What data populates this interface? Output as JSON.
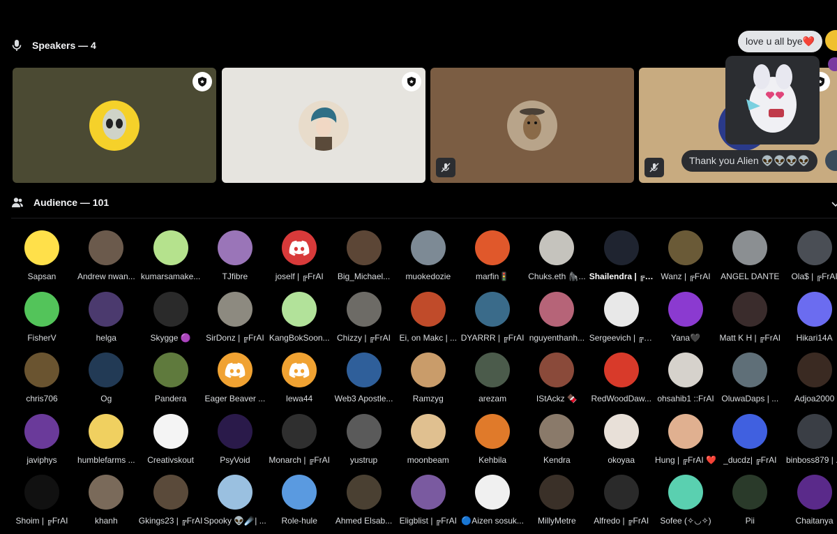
{
  "speakers": {
    "header": "Speakers — 4"
  },
  "audience": {
    "header": "Audience — 101"
  },
  "reactions": {
    "top": "love u all bye❤️",
    "bottom": "Thank you Alien 👽👽👽👽"
  },
  "colors": {
    "background": "#000000",
    "tile1": "#4b4a33",
    "tile2": "#e6e4df",
    "tile3": "#7b5d43",
    "tile4": "#c8ab80",
    "discord_red": "#d83a3a",
    "discord_orange": "#f0a232"
  },
  "icons": {
    "speakers": "microphone-icon",
    "audience": "people-icon",
    "badge": "stage-moderator-icon",
    "mute": "muted-mic-icon"
  },
  "audience_rows": [
    [
      {
        "name": "Sapsan",
        "color": "#ffe04a"
      },
      {
        "name": "Andrew nwan...",
        "color": "#6b5a4c"
      },
      {
        "name": "kumarsamake...",
        "color": "#b5e28d"
      },
      {
        "name": "TJfibre",
        "color": "#9a75b8"
      },
      {
        "name": "joself | ╔FrAI",
        "color": "#d83a3a",
        "discord": true
      },
      {
        "name": "Big_Michael...",
        "color": "#5c4636"
      },
      {
        "name": "muokedozie",
        "color": "#7d8a95"
      },
      {
        "name": "marfin🚦",
        "color": "#e0582b"
      },
      {
        "name": "Chuks.eth 🦍...",
        "color": "#c5c3bd"
      },
      {
        "name": "Shailendra | ╔F...",
        "color": "#1f2430",
        "bold": true
      },
      {
        "name": "Wanz | ╔FrAI",
        "color": "#6a5a37"
      },
      {
        "name": "ANGEL DANTE",
        "color": "#8b8f92"
      },
      {
        "name": "Ola$ | ╔FrAI",
        "color": "#4a4e55"
      }
    ],
    [
      {
        "name": "FisherV",
        "color": "#53c45a"
      },
      {
        "name": "helga",
        "color": "#4b3a6e"
      },
      {
        "name": "Skygge 🟣",
        "color": "#2a2a2a"
      },
      {
        "name": "SirDonz | ╔FrAI",
        "color": "#8d8a80"
      },
      {
        "name": "KangBokSoon...",
        "color": "#b2e29a"
      },
      {
        "name": "Chizzy | ╔FrAI",
        "color": "#6d6b66"
      },
      {
        "name": "Ei, on Makc | ...",
        "color": "#c04b2a"
      },
      {
        "name": "DYARRR | ╔FrAI",
        "color": "#3a6b8a"
      },
      {
        "name": "nguyenthanh...",
        "color": "#b66478"
      },
      {
        "name": "Sergeevich | ╔F...",
        "color": "#e8e8e8"
      },
      {
        "name": "Yana🖤",
        "color": "#8b3ad0"
      },
      {
        "name": "Matt K H | ╔FrAI",
        "color": "#3a2c2c"
      },
      {
        "name": "Hikari14A",
        "color": "#6b6cf0"
      }
    ],
    [
      {
        "name": "chris706",
        "color": "#6a5430"
      },
      {
        "name": "Og",
        "color": "#223a55"
      },
      {
        "name": "Pandera",
        "color": "#5f7a3d"
      },
      {
        "name": "Eager Beaver ...",
        "color": "#f0a232",
        "discord": true
      },
      {
        "name": "lewa44",
        "color": "#f0a232",
        "discord": true
      },
      {
        "name": "Web3 Apostle...",
        "color": "#2f5f9a"
      },
      {
        "name": "Ramzyg",
        "color": "#c99c6a"
      },
      {
        "name": "arezam",
        "color": "#4b5b4b"
      },
      {
        "name": "IStAckz 🍫",
        "color": "#8a4a3a"
      },
      {
        "name": "RedWoodDaw...",
        "color": "#d83a2a"
      },
      {
        "name": "ohsahib1 ::FrAI",
        "color": "#d6d2cc"
      },
      {
        "name": "OluwaDaps | ...",
        "color": "#5f6f78"
      },
      {
        "name": "Adjoa2000",
        "color": "#3a2a22"
      }
    ],
    [
      {
        "name": "javiphys",
        "color": "#6a3a9a"
      },
      {
        "name": "humblefarms ...",
        "color": "#f0d060"
      },
      {
        "name": "Creativskout",
        "color": "#f4f4f4"
      },
      {
        "name": "PsyVoid",
        "color": "#2a1a4a"
      },
      {
        "name": "Monarch | ╔FrAI",
        "color": "#2f2f2f"
      },
      {
        "name": "yustrup",
        "color": "#5a5a5a"
      },
      {
        "name": "moonbeam",
        "color": "#e0c090"
      },
      {
        "name": "Kehbila",
        "color": "#e07a2a"
      },
      {
        "name": "Kendra",
        "color": "#8a7a6a"
      },
      {
        "name": "okoyaa",
        "color": "#e8e0d8"
      },
      {
        "name": "Hung | ╔FrAI ❤️",
        "color": "#e0b090"
      },
      {
        "name": "_ducdz| ╔FrAI",
        "color": "#4060e0"
      },
      {
        "name": "binboss879 | ...",
        "color": "#3a3e45"
      }
    ],
    [
      {
        "name": "Shoim | ╔FrAI",
        "color": "#111111"
      },
      {
        "name": "khanh",
        "color": "#7a6a5a"
      },
      {
        "name": "Gkings23 | ╔FrAI",
        "color": "#5a4a3a"
      },
      {
        "name": "Spooky 👽☄️| ...",
        "color": "#9ac0e0"
      },
      {
        "name": "Role-hule",
        "color": "#5a9ae0"
      },
      {
        "name": "Ahmed Elsab...",
        "color": "#4a4032"
      },
      {
        "name": "Eligblist | ╔FrAI",
        "color": "#7a5aa0"
      },
      {
        "name": "🔵Aizen sosuk...",
        "color": "#f0f0f0"
      },
      {
        "name": "MillyMetre",
        "color": "#3a3028"
      },
      {
        "name": "Alfredo | ╔FrAI",
        "color": "#2a2a2a"
      },
      {
        "name": "Sofee (✧◡✧)",
        "color": "#5ad0b0"
      },
      {
        "name": "Pii",
        "color": "#2a3a2a"
      },
      {
        "name": "Chaitanya",
        "color": "#5a2a8a"
      }
    ]
  ]
}
